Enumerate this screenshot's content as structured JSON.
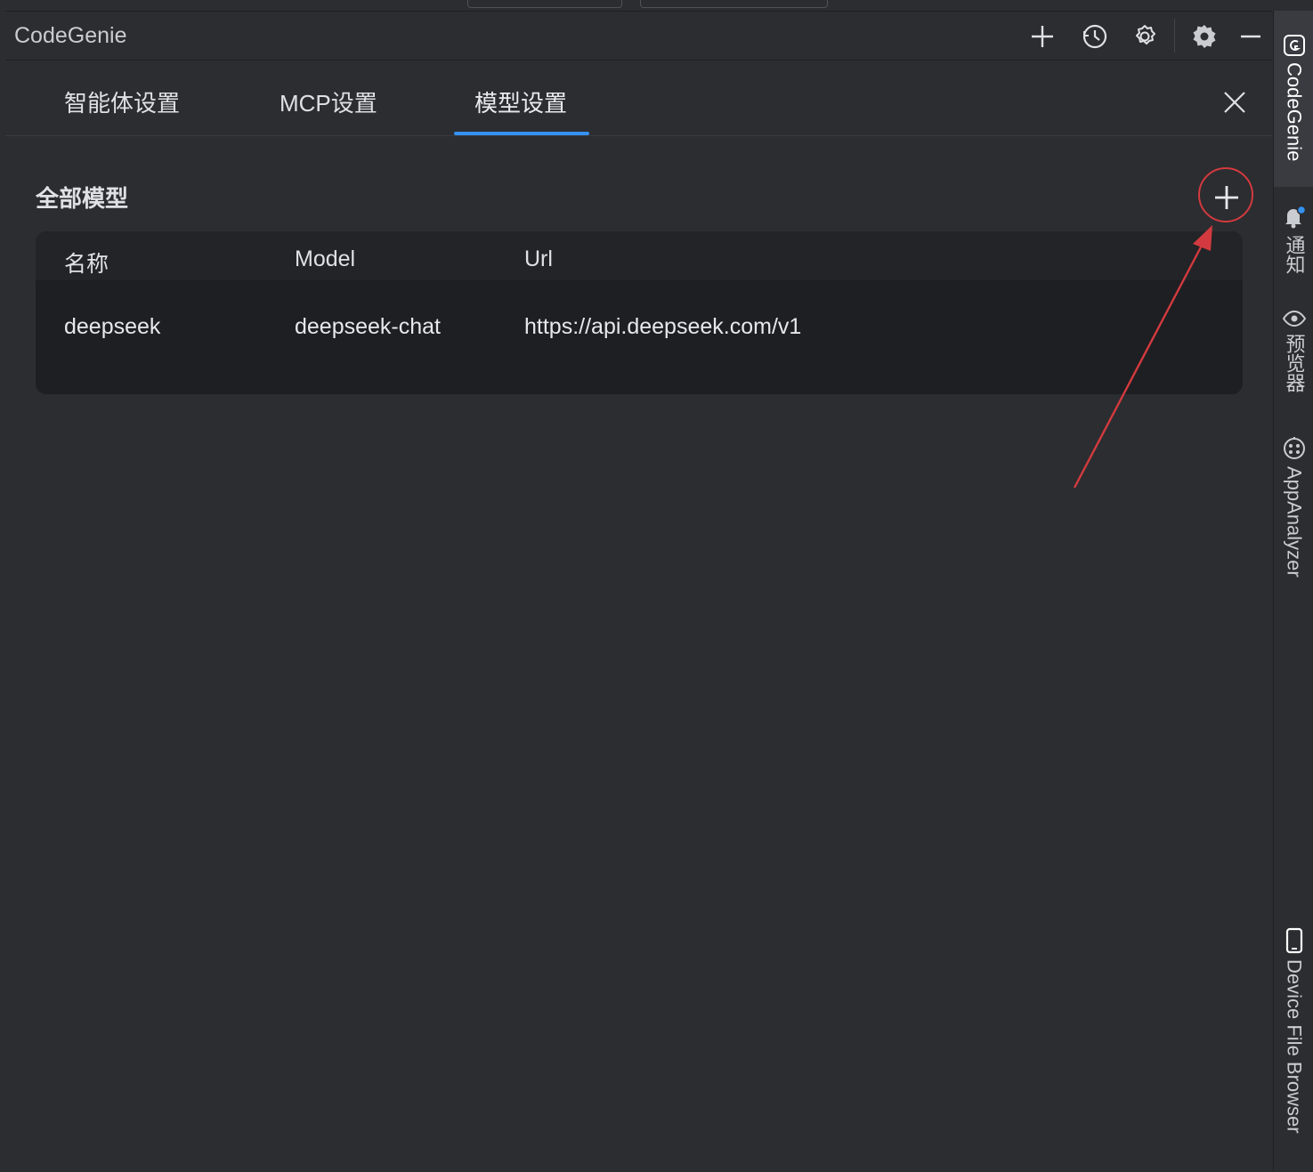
{
  "window": {
    "title": "CodeGenie"
  },
  "toolbar": {
    "icons": [
      "plus-icon",
      "history-icon",
      "settings-outline-icon",
      "gear-icon",
      "minimize-icon"
    ]
  },
  "tabs": [
    {
      "label": "智能体设置",
      "active": false
    },
    {
      "label": "MCP设置",
      "active": false
    },
    {
      "label": "模型设置",
      "active": true
    }
  ],
  "section": {
    "title": "全部模型",
    "add_icon": "plus-icon"
  },
  "table": {
    "headers": [
      "名称",
      "Model",
      "Url"
    ],
    "rows": [
      {
        "name": "deepseek",
        "model": "deepseek-chat",
        "url": "https://api.deepseek.com/v1"
      }
    ]
  },
  "right_strip": {
    "items": [
      {
        "label": "CodeGenie",
        "icon": "codegenie-icon",
        "active": true
      },
      {
        "label": "通知",
        "icon": "bell-icon",
        "active": false
      },
      {
        "label": "预览器",
        "icon": "eye-icon",
        "active": false
      },
      {
        "label": "AppAnalyzer",
        "icon": "analyzer-icon",
        "active": false
      },
      {
        "label": "Device File Browser",
        "icon": "phone-icon",
        "active": false
      }
    ]
  },
  "colors": {
    "background": "#2b2d30",
    "table_bg": "#1e1f22",
    "accent": "#3592f2",
    "annotation": "#d33a3f",
    "notification_dot": "#3592f2"
  }
}
